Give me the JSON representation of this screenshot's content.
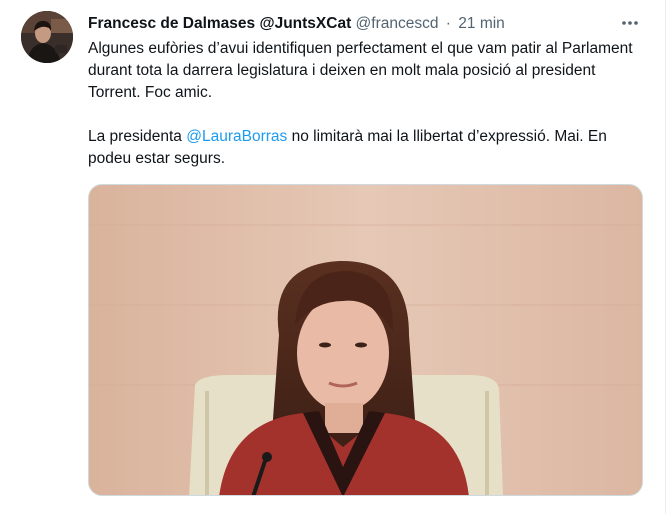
{
  "tweet": {
    "author_name": "Francesc de Dalmases @JuntsXCat",
    "author_handle": "@francescd",
    "separator": "·",
    "time": "21 min",
    "more_icon": "more-horizontal-icon",
    "paragraph1": "Algunes eufòries d’avui identifiquen perfectament el que vam patir al Parlament durant tota la darrera legislatura i deixen en molt mala posició al president Torrent. Foc amic.",
    "paragraph2_before": "La presidenta ",
    "mention": "@LauraBorras",
    "paragraph2_after": " no limitarà mai la llibertat d’expressió. Mai. En podeu estar segurs."
  },
  "colors": {
    "text": "#0f1419",
    "secondary": "#536471",
    "link": "#1d9bf0"
  }
}
